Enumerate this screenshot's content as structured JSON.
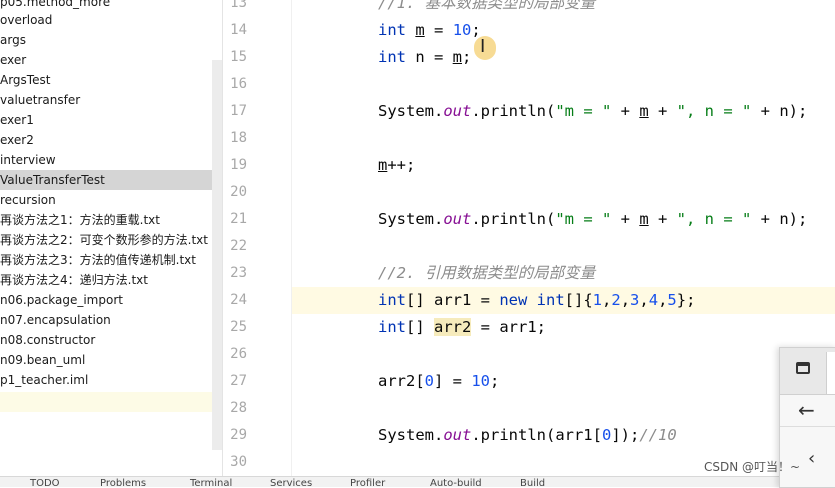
{
  "project_tree": {
    "items": [
      {
        "label": "p05.method_more"
      },
      {
        "label": "overload"
      },
      {
        "label": "args"
      },
      {
        "label": "exer"
      },
      {
        "label": "ArgsTest"
      },
      {
        "label": "valuetransfer"
      },
      {
        "label": "exer1"
      },
      {
        "label": "exer2"
      },
      {
        "label": "interview"
      },
      {
        "label": "ValueTransferTest"
      },
      {
        "label": "recursion"
      },
      {
        "label": "再谈方法之1：方法的重载.txt"
      },
      {
        "label": "再谈方法之2：可变个数形参的方法.txt"
      },
      {
        "label": "再谈方法之3：方法的值传递机制.txt"
      },
      {
        "label": "再谈方法之4：递归方法.txt"
      },
      {
        "label": "n06.package_import"
      },
      {
        "label": "n07.encapsulation"
      },
      {
        "label": "n08.constructor"
      },
      {
        "label": "n09.bean_uml"
      },
      {
        "label": "p1_teacher.iml"
      }
    ]
  },
  "editor": {
    "line_numbers": [
      "13",
      "14",
      "15",
      "16",
      "17",
      "18",
      "19",
      "20",
      "21",
      "22",
      "23",
      "24",
      "25",
      "26",
      "27",
      "28",
      "29",
      "30"
    ],
    "lines": {
      "l13": "//1. 基本数据类型的局部变量",
      "l14": [
        "int",
        " ",
        "m",
        " = ",
        "10",
        ";"
      ],
      "l15": [
        "int",
        " n = ",
        "m",
        ";"
      ],
      "l17": [
        "System.",
        "out",
        ".println(",
        "\"m = \"",
        " + ",
        "m",
        " + ",
        "\", n = \"",
        " + n);"
      ],
      "l19": [
        "m",
        "++;"
      ],
      "l21": [
        "System.",
        "out",
        ".println(",
        "\"m = \"",
        " + ",
        "m",
        " + ",
        "\", n = \"",
        " + n);"
      ],
      "l23": "//2. 引用数据类型的局部变量",
      "l24": [
        "int",
        "[] arr1 = ",
        "new",
        " ",
        "int",
        "[]{",
        "1",
        ",",
        "2",
        ",",
        "3",
        ",",
        "4",
        ",",
        "5",
        "};"
      ],
      "l25": [
        "int",
        "[] ",
        "arr2",
        " = arr1;"
      ],
      "l27": [
        "arr2[",
        "0",
        "] = ",
        "10",
        ";"
      ],
      "l29": [
        "System.",
        "out",
        ".println(arr1[",
        "0",
        "]);",
        "//10"
      ]
    }
  },
  "bottom_bar": {
    "items": [
      "TODO",
      "Problems",
      "Terminal",
      "Services",
      "Profiler",
      "Auto-build",
      "Build"
    ]
  },
  "watermark": "CSDN @叮当！~",
  "colors": {
    "keyword": "#0033b3",
    "number": "#1750eb",
    "string": "#067d17",
    "static_field": "#871094",
    "comment": "#8c8c8c",
    "selection_row": "#d5d5d5",
    "caret_row": "#fffae3"
  }
}
